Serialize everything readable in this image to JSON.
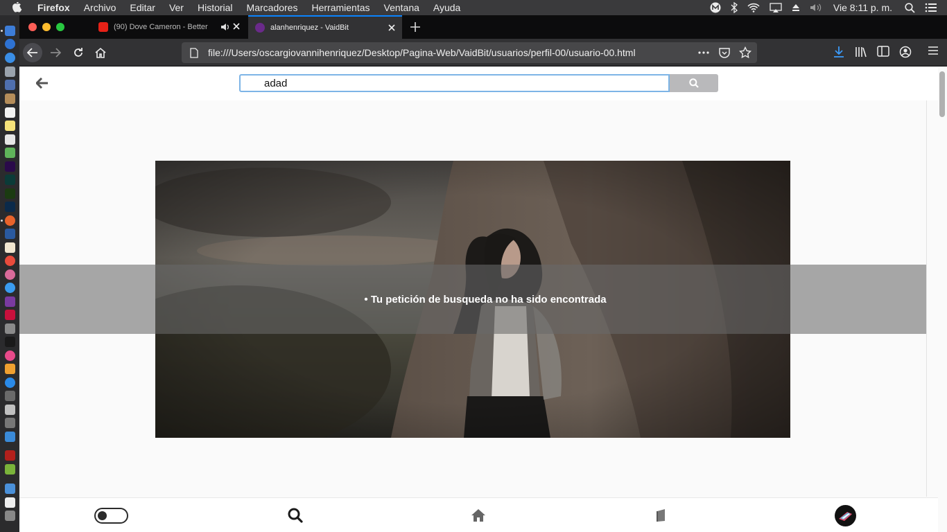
{
  "menubar": {
    "app_name": "Firefox",
    "items": [
      "Archivo",
      "Editar",
      "Ver",
      "Historial",
      "Marcadores",
      "Herramientas",
      "Ventana",
      "Ayuda"
    ],
    "clock": "Vie 8:11 p. m."
  },
  "tabs": [
    {
      "title": "(90) Dove Cameron - Better",
      "active": false,
      "muted_icon": "speaker-icon"
    },
    {
      "title": "alanhenriquez - VaidBit",
      "active": true
    }
  ],
  "urlbar": {
    "url": "file:///Users/oscargiovannihenriquez/Desktop/Pagina-Web/VaidBit/usuarios/perfil-00/usuario-00.html"
  },
  "search": {
    "value": "adad"
  },
  "notice": {
    "text": "• Tu petición de busqueda no ha sido encontrada"
  },
  "colors": {
    "accent": "#0a84ff",
    "search_border": "#7db4e6",
    "search_button": "#b9b9bb",
    "notice_overlay": "#696969"
  }
}
